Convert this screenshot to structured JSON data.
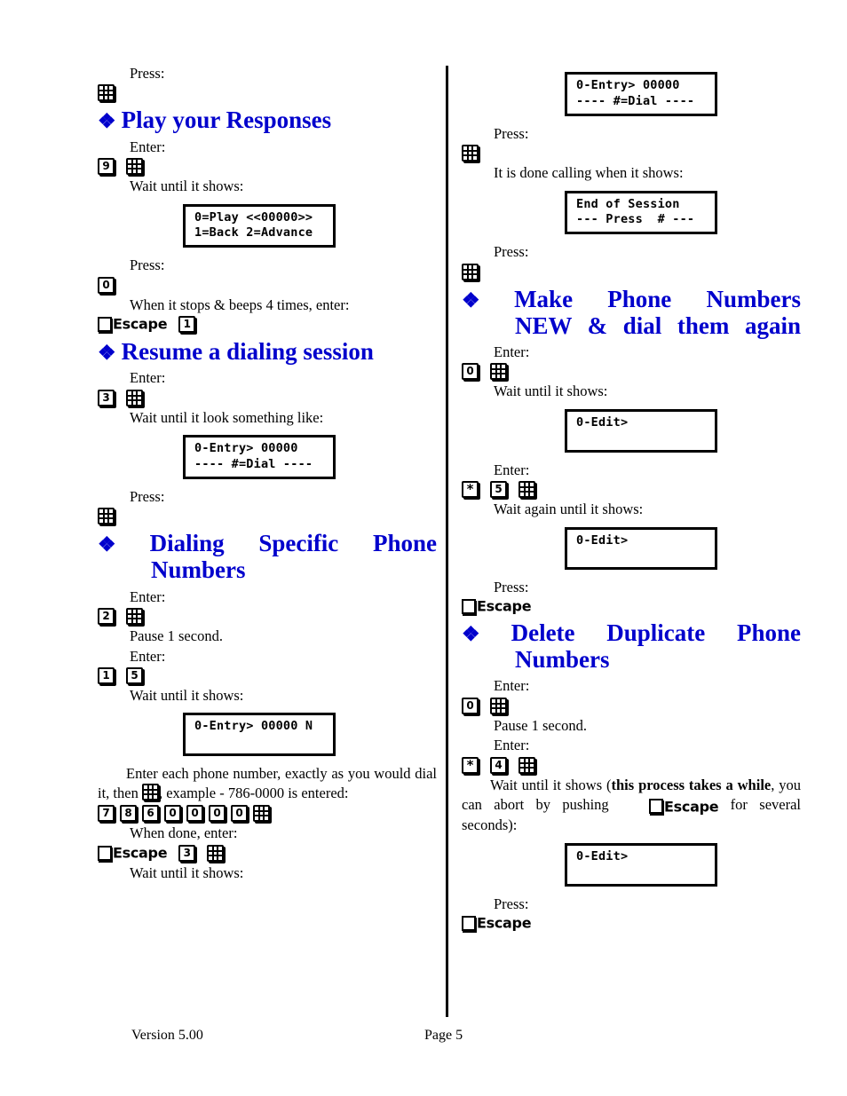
{
  "document": {
    "colors": {
      "heading": "#0000CC",
      "body": "#000000",
      "page_bg": "#FFFFFF"
    }
  },
  "footer": {
    "version": "Version 5.00",
    "page": "Page 5"
  },
  "left_column": {
    "intro_press_label": "Press:",
    "intro_key": "#",
    "sections": [
      {
        "title": "Play your Responses",
        "enter_label": "Enter:",
        "keys_1": [
          "9",
          "#"
        ],
        "wait_label": "Wait until it shows:",
        "lcd_1_line1": "0=Play <<00000>>",
        "lcd_1_line2": "1=Back 2=Advance",
        "press_label": "Press:",
        "press_key": "0",
        "beeps_label": "When it stops & beeps 4 times, enter:",
        "escape_label": "Escape",
        "final_key": "1"
      },
      {
        "title": "Resume a dialing session",
        "enter_label": "Enter:",
        "keys_1": [
          "3",
          "#"
        ],
        "wait_label": "Wait until it look something like:",
        "lcd_1_line1": "0-Entry> 00000",
        "lcd_1_line2": "---- #=Dial ----",
        "press_label": "Press:",
        "press_key": "#"
      },
      {
        "title_words": [
          "Dialing",
          "Specific",
          "Phone"
        ],
        "title_last": "Numbers",
        "enter_label_1": "Enter:",
        "keys_1": [
          "2",
          "#"
        ],
        "pause_label": "Pause 1 second.",
        "enter_label_2": "Enter:",
        "keys_2": [
          "1",
          "5"
        ],
        "wait_label_1": "Wait until it shows:",
        "lcd_1_line1": "0-Entry> 00000 N",
        "lcd_1_line2": "",
        "instruction_part1": "Enter each phone number, exactly as you would dial it, then ",
        "instruction_key": "#",
        "instruction_part2": ", example - 786-0000 is entered:",
        "number_keys": [
          "7",
          "8",
          "6",
          "0",
          "0",
          "0",
          "0",
          "#"
        ],
        "when_done_label": "When done, enter:",
        "escape_label": "Escape",
        "done_keys": [
          "3",
          "#"
        ],
        "wait_label_2": "Wait until it shows:"
      }
    ]
  },
  "right_column": {
    "lcd_top_line1": "0-Entry> 00000",
    "lcd_top_line2": "---- #=Dial ----",
    "press_label_1": "Press:",
    "press_key_1": "#",
    "done_calling_label": "It is done calling when it shows:",
    "lcd_end_line1": "End of Session",
    "lcd_end_line2": "--- Press  # ---",
    "press_label_2": "Press:",
    "press_key_2": "#",
    "sections": [
      {
        "title_words": [
          "Make",
          "Phone",
          "Numbers"
        ],
        "title_last": "NEW & dial them again",
        "enter_label_1": "Enter:",
        "keys_1": [
          "0",
          "#"
        ],
        "wait_label_1": "Wait until it shows:",
        "lcd_1_line1": "0-Edit>",
        "lcd_1_line2": "",
        "enter_label_2": "Enter:",
        "keys_2": [
          "*",
          "5",
          "#"
        ],
        "wait_label_2": "Wait again until it shows:",
        "lcd_2_line1": "0-Edit>",
        "lcd_2_line2": "",
        "press_label": "Press:",
        "escape_label": "Escape"
      },
      {
        "title_words": [
          "Delete",
          "Duplicate",
          "Phone"
        ],
        "title_last": "Numbers",
        "enter_label_1": "Enter:",
        "keys_1": [
          "0",
          "#"
        ],
        "pause_label": "Pause 1 second.",
        "enter_label_2": "Enter:",
        "keys_2": [
          "*",
          "4",
          "#"
        ],
        "wait_part1": "Wait until it shows (",
        "wait_bold": "this process takes a while",
        "wait_part2": ", you can abort by pushing ",
        "wait_escape_label": "Escape",
        "wait_part3": " for several seconds):",
        "lcd_1_line1": "0-Edit>",
        "lcd_1_line2": "",
        "press_label": "Press:",
        "escape_label": "Escape"
      }
    ]
  }
}
